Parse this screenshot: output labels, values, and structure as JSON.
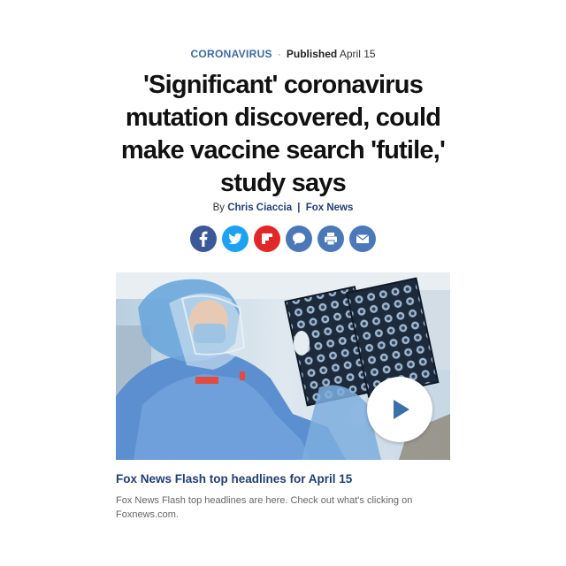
{
  "article": {
    "category": "CORONAVIRUS",
    "separator": "·",
    "published_label": "Published",
    "published_date": "April 15",
    "headline": "'Significant' coronavirus mutation discovered, could make vaccine search 'futile,' study says",
    "byline_prefix": "By",
    "author": "Chris Ciaccia",
    "byline_divider": "|",
    "outlet": "Fox News"
  },
  "share": {
    "buttons": [
      {
        "name": "facebook",
        "icon": "facebook-icon",
        "color": "#3b5998"
      },
      {
        "name": "twitter",
        "icon": "twitter-icon",
        "color": "#1da1f2"
      },
      {
        "name": "flipboard",
        "icon": "flipboard-icon",
        "color": "#e12828"
      },
      {
        "name": "comments",
        "icon": "comment-icon",
        "color": "#4a78b8"
      },
      {
        "name": "print",
        "icon": "print-icon",
        "color": "#4a78b8"
      },
      {
        "name": "email",
        "icon": "email-icon",
        "color": "#4a78b8"
      }
    ]
  },
  "video": {
    "play_icon": "play-icon",
    "title": "Fox News Flash top headlines for April 15",
    "description": "Fox News Flash top headlines are here. Check out what's clicking on Foxnews.com."
  },
  "colors": {
    "category": "#3c6a9e",
    "link": "#1f3f72",
    "play": "#3a6fa8"
  }
}
